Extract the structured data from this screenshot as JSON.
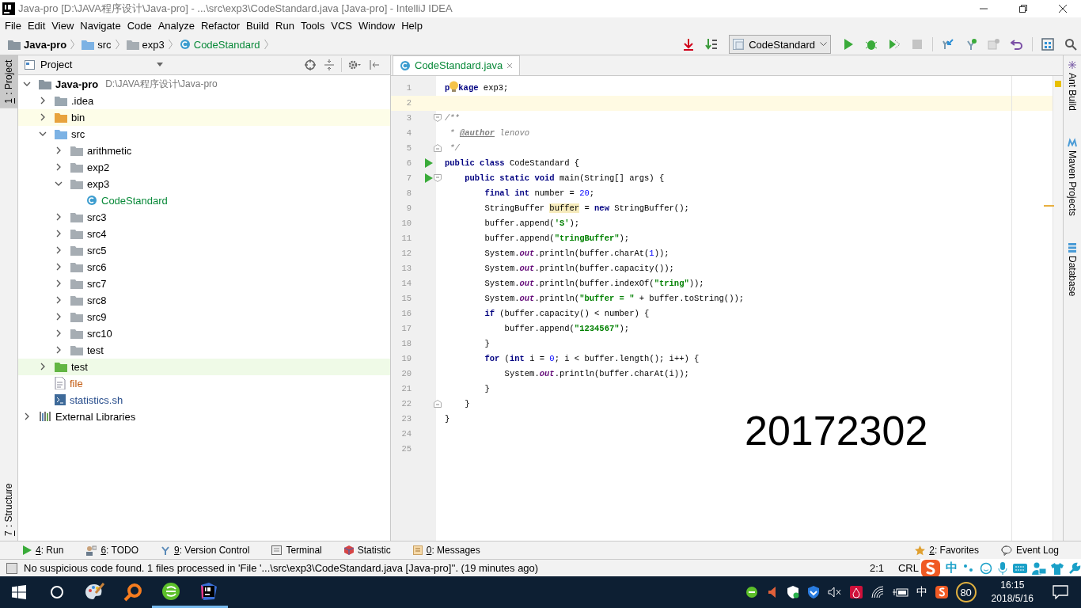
{
  "window": {
    "title": "Java-pro [D:\\JAVA程序设计\\Java-pro] - ...\\src\\exp3\\CodeStandard.java [Java-pro] - IntelliJ IDEA"
  },
  "menu": [
    "File",
    "Edit",
    "View",
    "Navigate",
    "Code",
    "Analyze",
    "Refactor",
    "Build",
    "Run",
    "Tools",
    "VCS",
    "Window",
    "Help"
  ],
  "breadcrumbs": [
    {
      "label": "Java-pro",
      "kind": "module"
    },
    {
      "label": "src",
      "kind": "source"
    },
    {
      "label": "exp3",
      "kind": "package"
    },
    {
      "label": "CodeStandard",
      "kind": "class"
    }
  ],
  "run_config": "CodeStandard",
  "left_tabs": [
    {
      "key": "1",
      "label": ": Project",
      "selected": true
    },
    {
      "key": "7",
      "label": ": Structure",
      "selected": false
    }
  ],
  "project": {
    "title": "Project",
    "tree": [
      {
        "label": "Java-pro",
        "kind": "module",
        "path": "D:\\JAVA程序设计\\Java-pro",
        "expanded": true,
        "children": [
          {
            "label": ".idea",
            "kind": "folder",
            "expanded": false
          },
          {
            "label": "bin",
            "kind": "excluded",
            "expanded": false
          },
          {
            "label": "src",
            "kind": "source",
            "expanded": true,
            "children": [
              {
                "label": "arithmetic",
                "kind": "package",
                "expanded": false
              },
              {
                "label": "exp2",
                "kind": "package",
                "expanded": false
              },
              {
                "label": "exp3",
                "kind": "package",
                "expanded": true,
                "children": [
                  {
                    "label": "CodeStandard",
                    "kind": "class"
                  }
                ]
              },
              {
                "label": "src3",
                "kind": "package",
                "expanded": false
              },
              {
                "label": "src4",
                "kind": "package",
                "expanded": false
              },
              {
                "label": "src5",
                "kind": "package",
                "expanded": false
              },
              {
                "label": "src6",
                "kind": "package",
                "expanded": false
              },
              {
                "label": "src7",
                "kind": "package",
                "expanded": false
              },
              {
                "label": "src8",
                "kind": "package",
                "expanded": false
              },
              {
                "label": "src9",
                "kind": "package",
                "expanded": false
              },
              {
                "label": "src10",
                "kind": "package",
                "expanded": false
              },
              {
                "label": "test",
                "kind": "package",
                "expanded": false
              }
            ]
          },
          {
            "label": "test",
            "kind": "test",
            "expanded": false
          },
          {
            "label": "file",
            "kind": "file"
          },
          {
            "label": "statistics.sh",
            "kind": "script"
          }
        ]
      },
      {
        "label": "External Libraries",
        "kind": "library",
        "expanded": false
      }
    ]
  },
  "editor": {
    "tabs": [
      {
        "label": "CodeStandard.java",
        "selected": true
      }
    ],
    "lines": [
      {
        "number": "1",
        "current": false,
        "runnable": false,
        "fold_open": false,
        "fold_close": false,
        "tokens": [
          {
            "kind": "kw",
            "text": "p"
          },
          {
            "kind": "bulb"
          },
          {
            "kind": "kw",
            "text": "kage"
          },
          {
            "kind": "plain",
            "text": " exp3;"
          }
        ]
      },
      {
        "number": "2",
        "current": true,
        "runnable": false,
        "fold_open": false,
        "fold_close": false
      },
      {
        "number": "3",
        "current": false,
        "runnable": false,
        "fold_open": true,
        "fold_close": false,
        "tokens": [
          {
            "kind": "comment",
            "text": "/**"
          }
        ]
      },
      {
        "number": "4",
        "current": false,
        "runnable": false,
        "fold_open": false,
        "fold_close": false,
        "tokens": [
          {
            "kind": "comment",
            "text": " * "
          },
          {
            "kind": "doctag",
            "text": "@author"
          },
          {
            "kind": "comment",
            "text": " lenovo"
          }
        ]
      },
      {
        "number": "5",
        "current": false,
        "runnable": false,
        "fold_open": false,
        "fold_close": true,
        "tokens": [
          {
            "kind": "comment",
            "text": " */"
          }
        ]
      },
      {
        "number": "6",
        "current": false,
        "runnable": true,
        "fold_open": false,
        "fold_close": false,
        "tokens": [
          {
            "kind": "kw",
            "text": "public class"
          },
          {
            "kind": "plain",
            "text": " CodeStandard {"
          }
        ]
      },
      {
        "number": "7",
        "current": false,
        "runnable": true,
        "fold_open": true,
        "fold_close": false,
        "tokens": [
          {
            "kind": "kw",
            "text": "    public static void"
          },
          {
            "kind": "plain",
            "text": " main(String[] args) {"
          }
        ]
      },
      {
        "number": "8",
        "current": false,
        "runnable": false,
        "fold_open": false,
        "fold_close": false,
        "tokens": [
          {
            "kind": "kw",
            "text": "        final int"
          },
          {
            "kind": "plain",
            "text": " number = "
          },
          {
            "kind": "num",
            "text": "20"
          },
          {
            "kind": "plain",
            "text": ";"
          }
        ]
      },
      {
        "number": "9",
        "current": false,
        "runnable": false,
        "fold_open": false,
        "fold_close": false,
        "tokens": [
          {
            "kind": "plain",
            "text": "        StringBuffer "
          },
          {
            "kind": "usage",
            "text": "buffer"
          },
          {
            "kind": "plain",
            "text": " = "
          },
          {
            "kind": "kw",
            "text": "new"
          },
          {
            "kind": "plain",
            "text": " StringBuffer();"
          }
        ]
      },
      {
        "number": "10",
        "current": false,
        "runnable": false,
        "fold_open": false,
        "fold_close": false,
        "tokens": [
          {
            "kind": "plain",
            "text": "        buffer.append("
          },
          {
            "kind": "str",
            "text": "'S'"
          },
          {
            "kind": "plain",
            "text": ");"
          }
        ]
      },
      {
        "number": "11",
        "current": false,
        "runnable": false,
        "fold_open": false,
        "fold_close": false,
        "tokens": [
          {
            "kind": "plain",
            "text": "        buffer.append("
          },
          {
            "kind": "str",
            "text": "\"tringBuffer\""
          },
          {
            "kind": "plain",
            "text": ");"
          }
        ]
      },
      {
        "number": "12",
        "current": false,
        "runnable": false,
        "fold_open": false,
        "fold_close": false,
        "tokens": [
          {
            "kind": "plain",
            "text": "        System."
          },
          {
            "kind": "field",
            "text": "out"
          },
          {
            "kind": "plain",
            "text": ".println(buffer.charAt("
          },
          {
            "kind": "num",
            "text": "1"
          },
          {
            "kind": "plain",
            "text": "));"
          }
        ]
      },
      {
        "number": "13",
        "current": false,
        "runnable": false,
        "fold_open": false,
        "fold_close": false,
        "tokens": [
          {
            "kind": "plain",
            "text": "        System."
          },
          {
            "kind": "field",
            "text": "out"
          },
          {
            "kind": "plain",
            "text": ".println(buffer.capacity());"
          }
        ]
      },
      {
        "number": "14",
        "current": false,
        "runnable": false,
        "fold_open": false,
        "fold_close": false,
        "tokens": [
          {
            "kind": "plain",
            "text": "        System."
          },
          {
            "kind": "field",
            "text": "out"
          },
          {
            "kind": "plain",
            "text": ".println(buffer.indexOf("
          },
          {
            "kind": "str",
            "text": "\"tring\""
          },
          {
            "kind": "plain",
            "text": "));"
          }
        ]
      },
      {
        "number": "15",
        "current": false,
        "runnable": false,
        "fold_open": false,
        "fold_close": false,
        "tokens": [
          {
            "kind": "plain",
            "text": "        System."
          },
          {
            "kind": "field",
            "text": "out"
          },
          {
            "kind": "plain",
            "text": ".println("
          },
          {
            "kind": "str",
            "text": "\"buffer = \""
          },
          {
            "kind": "plain",
            "text": " + buffer.toString());"
          }
        ]
      },
      {
        "number": "16",
        "current": false,
        "runnable": false,
        "fold_open": false,
        "fold_close": false,
        "tokens": [
          {
            "kind": "kw",
            "text": "        if"
          },
          {
            "kind": "plain",
            "text": " (buffer.capacity() < number) {"
          }
        ]
      },
      {
        "number": "17",
        "current": false,
        "runnable": false,
        "fold_open": false,
        "fold_close": false,
        "tokens": [
          {
            "kind": "plain",
            "text": "            buffer.append("
          },
          {
            "kind": "str",
            "text": "\"1234567\""
          },
          {
            "kind": "plain",
            "text": ");"
          }
        ]
      },
      {
        "number": "18",
        "current": false,
        "runnable": false,
        "fold_open": false,
        "fold_close": false,
        "tokens": [
          {
            "kind": "plain",
            "text": "        }"
          }
        ]
      },
      {
        "number": "19",
        "current": false,
        "runnable": false,
        "fold_open": false,
        "fold_close": false,
        "tokens": [
          {
            "kind": "kw",
            "text": "        for"
          },
          {
            "kind": "plain",
            "text": " ("
          },
          {
            "kind": "kw",
            "text": "int"
          },
          {
            "kind": "plain",
            "text": " i = "
          },
          {
            "kind": "num",
            "text": "0"
          },
          {
            "kind": "plain",
            "text": "; i < buffer.length(); i++) {"
          }
        ]
      },
      {
        "number": "20",
        "current": false,
        "runnable": false,
        "fold_open": false,
        "fold_close": false,
        "tokens": [
          {
            "kind": "plain",
            "text": "            System."
          },
          {
            "kind": "field",
            "text": "out"
          },
          {
            "kind": "plain",
            "text": ".println(buffer.charAt(i));"
          }
        ]
      },
      {
        "number": "21",
        "current": false,
        "runnable": false,
        "fold_open": false,
        "fold_close": false,
        "tokens": [
          {
            "kind": "plain",
            "text": "        }"
          }
        ]
      },
      {
        "number": "22",
        "current": false,
        "runnable": false,
        "fold_open": false,
        "fold_close": true,
        "tokens": [
          {
            "kind": "plain",
            "text": "    }"
          }
        ]
      },
      {
        "number": "23",
        "current": false,
        "runnable": false,
        "fold_open": false,
        "fold_close": false,
        "tokens": [
          {
            "kind": "plain",
            "text": "}"
          }
        ]
      },
      {
        "number": "24",
        "current": false,
        "runnable": false,
        "fold_open": false,
        "fold_close": false
      },
      {
        "number": "25",
        "current": false,
        "runnable": false,
        "fold_open": false,
        "fold_close": false
      }
    ],
    "overlay_text": "20172302"
  },
  "right_tabs": [
    {
      "label": "Ant Build",
      "kind": "ant"
    },
    {
      "label": "Maven Projects",
      "kind": "maven"
    },
    {
      "label": "Database",
      "kind": "database"
    }
  ],
  "tool_tabs": [
    {
      "key": "4",
      "label": ": Run",
      "kind": "run"
    },
    {
      "key": "6",
      "label": ": TODO",
      "kind": "todo"
    },
    {
      "key": "9",
      "label": ": Version Control",
      "kind": "vcs"
    },
    {
      "label": "Terminal",
      "kind": "terminal"
    },
    {
      "label": "Statistic",
      "kind": "statistic"
    },
    {
      "key": "0",
      "label": ": Messages",
      "kind": "messages"
    }
  ],
  "tool_tabs_right": [
    {
      "key": "2",
      "label": ": Favorites",
      "kind": "favorites"
    },
    {
      "label": "Event Log",
      "kind": "eventlog"
    }
  ],
  "status_bar": {
    "message": "No suspicious code found. 1 files processed in 'File '...\\src\\exp3\\CodeStandard.java [Java-pro]''. (19 minutes ago)",
    "position": "2:1",
    "line_separator": "CRL",
    "ime_mode": "中"
  },
  "taskbar": {
    "apps": [
      {
        "kind": "start",
        "running": false
      },
      {
        "kind": "cortana",
        "running": false
      },
      {
        "kind": "paint",
        "running": false
      },
      {
        "kind": "search",
        "running": false
      },
      {
        "kind": "browser",
        "running": true
      },
      {
        "kind": "idea",
        "running": true
      }
    ],
    "ime": "中",
    "speed": "80",
    "time": "16:15",
    "date": "2018/5/16"
  }
}
